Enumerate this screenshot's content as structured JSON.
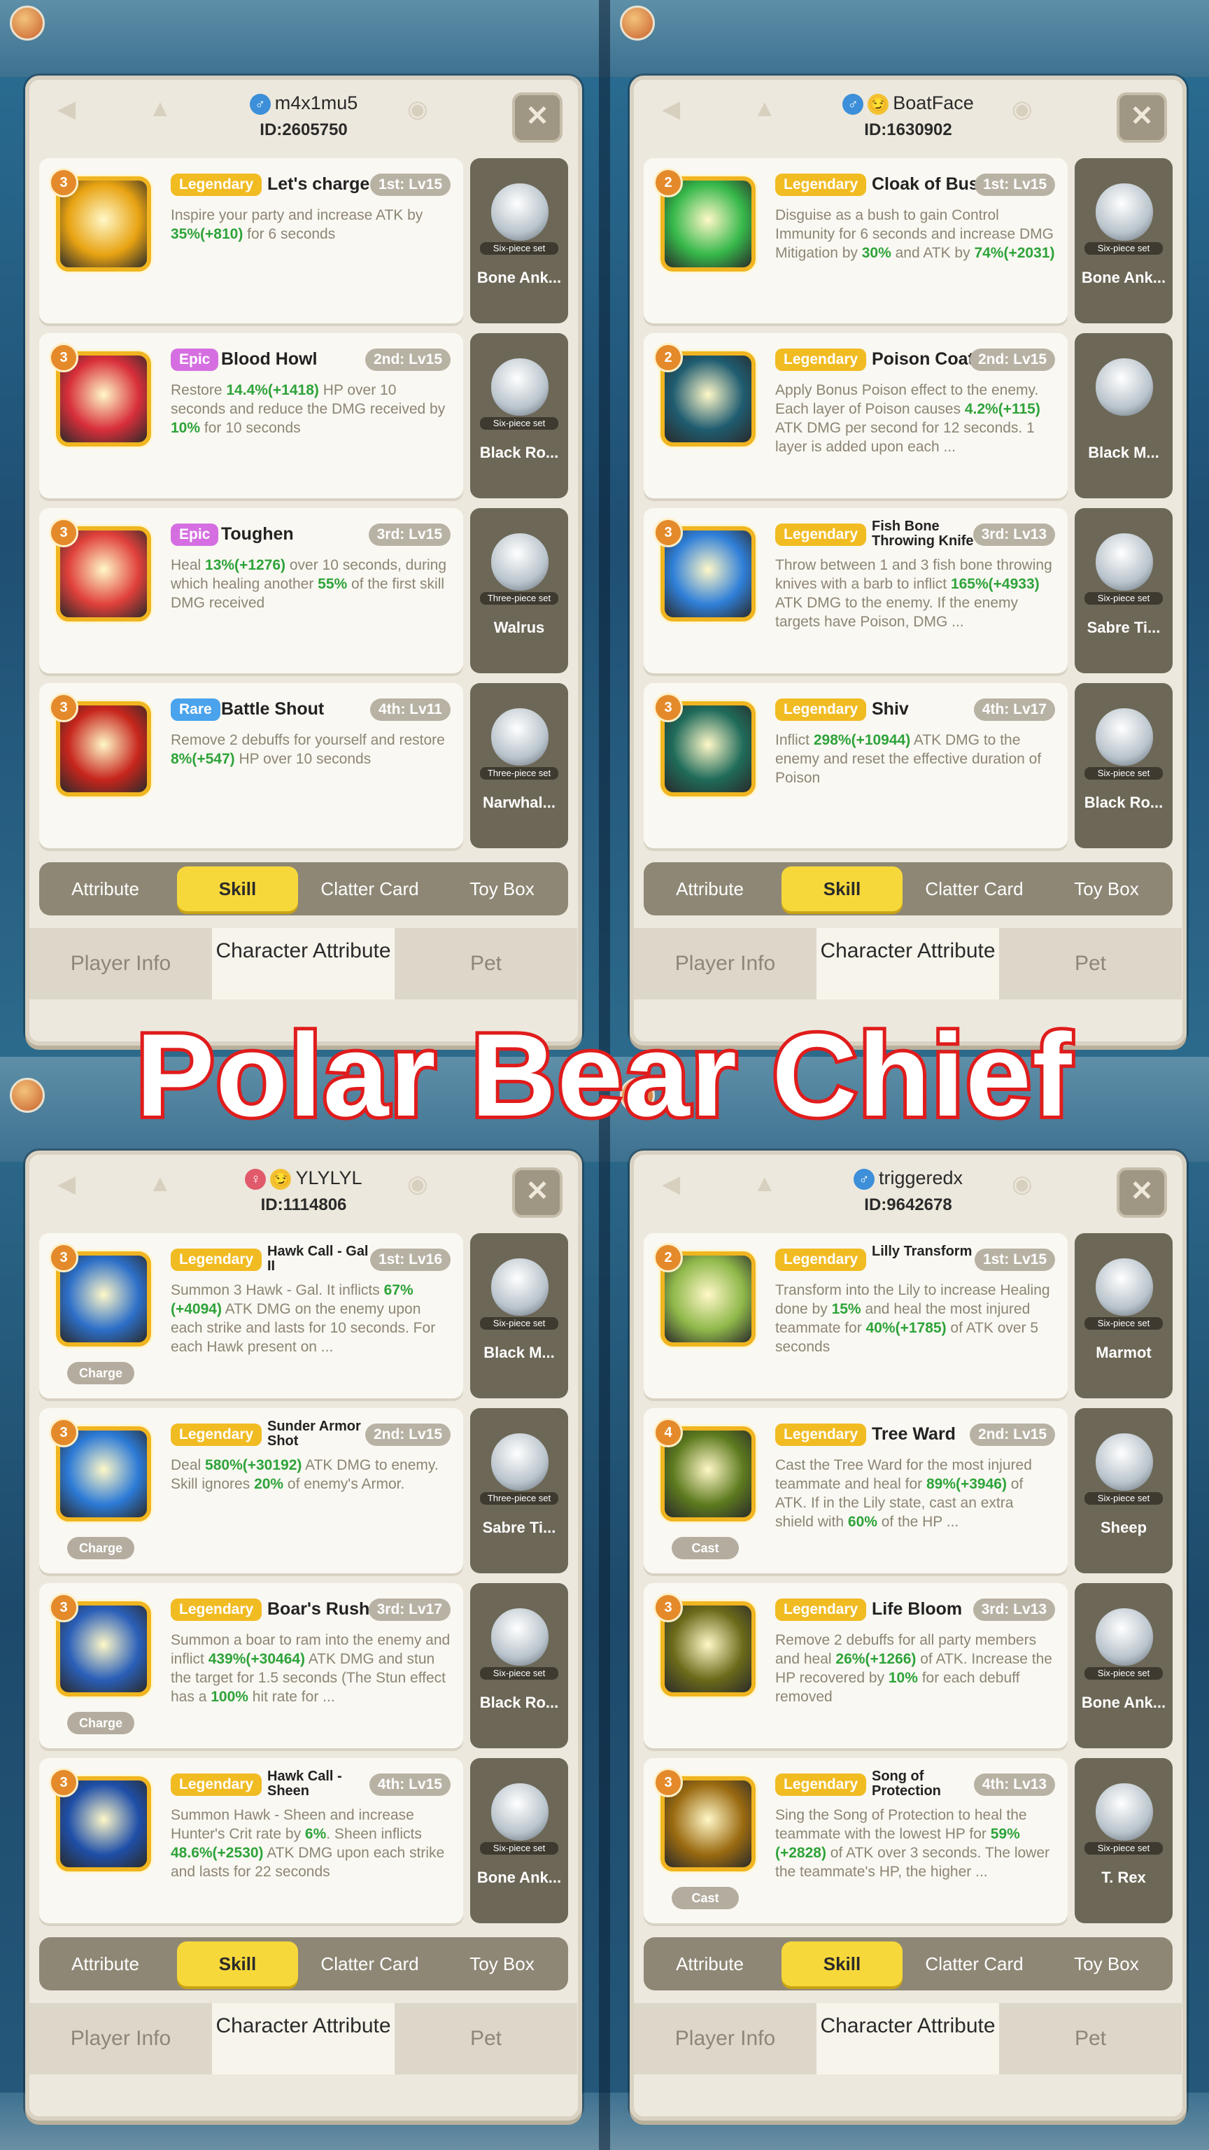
{
  "banner": "Polar Bear Chief",
  "subtabs": [
    "Attribute",
    "Skill",
    "Clatter Card",
    "Toy Box"
  ],
  "maintabs": [
    "Player Info",
    "Character Attribute",
    "Pet"
  ],
  "colors": {
    "legendary": "#f1bb22",
    "epic": "#d56fe1",
    "rare": "#4aa3ec",
    "green_value": "#2ea33a",
    "active_tab": "#f7d83b"
  },
  "panels": [
    {
      "name": "m4x1mu5",
      "id": "ID:2605750",
      "icons": [
        "gender-male-icon"
      ],
      "skills": [
        {
          "level": "3",
          "rarity": "Legendary",
          "name": "Let's charge",
          "slot": "1st: Lv15",
          "desc": "Inspire your party and increase ATK by 35%(+810) for 6 seconds",
          "badge": "",
          "pet_set": "Six-piece set",
          "pet": "Bone Ank...",
          "icon_color": "#e8a312"
        },
        {
          "level": "3",
          "rarity": "Epic",
          "name": "Blood Howl",
          "slot": "2nd: Lv15",
          "desc": "Restore 14.4%(+1418) HP over 10 seconds and reduce the DMG received by 10% for 10 seconds",
          "badge": "",
          "pet_set": "Six-piece set",
          "pet": "Black Ro...",
          "icon_color": "#d82f3a"
        },
        {
          "level": "3",
          "rarity": "Epic",
          "name": "Toughen",
          "slot": "3rd: Lv15",
          "desc": "Heal 13%(+1276) over 10 seconds, during which healing another 55% of the first skill DMG received",
          "badge": "",
          "pet_set": "Three-piece set",
          "pet": "Walrus",
          "icon_color": "#e0403a"
        },
        {
          "level": "3",
          "rarity": "Rare",
          "name": "Battle Shout",
          "slot": "4th: Lv11",
          "desc": "Remove 2 debuffs for yourself and restore 8%(+547) HP over 10 seconds",
          "badge": "",
          "pet_set": "Three-piece set",
          "pet": "Narwhal...",
          "icon_color": "#c7261c"
        }
      ]
    },
    {
      "name": "BoatFace",
      "id": "ID:1630902",
      "icons": [
        "gender-male-icon",
        "emoji-face-icon"
      ],
      "skills": [
        {
          "level": "2",
          "rarity": "Legendary",
          "name": "Cloak of Bush",
          "slot": "1st: Lv15",
          "desc": "Disguise as a bush to gain Control Immunity for 6 seconds and increase DMG Mitigation by 30% and ATK by 74%(+2031)",
          "badge": "",
          "pet_set": "Six-piece set",
          "pet": "Bone Ank...",
          "icon_color": "#36b84a"
        },
        {
          "level": "2",
          "rarity": "Legendary",
          "name": "Poison Coat",
          "slot": "2nd: Lv15",
          "desc": "Apply Bonus Poison effect to the enemy. Each layer of Poison causes 4.2%(+115) ATK DMG per second for 12 seconds. 1 layer is added upon each ...",
          "badge": "",
          "pet_set": "",
          "pet": "Black M...",
          "icon_color": "#1f5c70"
        },
        {
          "level": "3",
          "rarity": "Legendary",
          "name": "Fish Bone Throwing Knife",
          "slot": "3rd: Lv13",
          "desc": "Throw between 1 and 3 fish bone throwing knives with a barb to inflict 165%(+4933) ATK DMG to the enemy. If the enemy targets have Poison, DMG ...",
          "badge": "",
          "pet_set": "Six-piece set",
          "pet": "Sabre Ti...",
          "icon_color": "#2f7fd8"
        },
        {
          "level": "3",
          "rarity": "Legendary",
          "name": "Shiv",
          "slot": "4th: Lv17",
          "desc": "Inflict 298%(+10944) ATK DMG to the enemy and reset the effective duration of Poison",
          "badge": "",
          "pet_set": "Six-piece set",
          "pet": "Black Ro...",
          "icon_color": "#1f6b5a"
        }
      ]
    },
    {
      "name": "YLYLYL",
      "id": "ID:1114806",
      "icons": [
        "gender-female-icon",
        "emoji-face-icon"
      ],
      "skills": [
        {
          "level": "3",
          "rarity": "Legendary",
          "name": "Hawk Call - Gal II",
          "slot": "1st: Lv16",
          "desc": "Summon 3 Hawk - Gal. It inflicts 67%(+4094) ATK DMG on the enemy upon each strike and lasts for 10 seconds. For each Hawk present on ...",
          "badge": "Charge",
          "pet_set": "Six-piece set",
          "pet": "Black M...",
          "icon_color": "#2d6fc8"
        },
        {
          "level": "3",
          "rarity": "Legendary",
          "name": "Sunder Armor Shot",
          "slot": "2nd: Lv15",
          "desc": "Deal 580%(+30192) ATK DMG to enemy. Skill ignores 20% of enemy's Armor.",
          "badge": "Charge",
          "pet_set": "Three-piece set",
          "pet": "Sabre Ti...",
          "icon_color": "#2c7ad6"
        },
        {
          "level": "3",
          "rarity": "Legendary",
          "name": "Boar's Rush",
          "slot": "3rd: Lv17",
          "desc": "Summon a boar to ram into the enemy and inflict 439%(+30464) ATK DMG and stun the target for 1.5 seconds (The Stun effect has a 100% hit rate for ...",
          "badge": "Charge",
          "pet_set": "Six-piece set",
          "pet": "Black Ro...",
          "icon_color": "#2a5fb8"
        },
        {
          "level": "3",
          "rarity": "Legendary",
          "name": "Hawk Call - Sheen",
          "slot": "4th: Lv15",
          "desc": "Summon Hawk - Sheen and increase Hunter's Crit rate by 6%. Sheen inflicts 48.6%(+2530) ATK DMG upon each strike and lasts for 22 seconds",
          "badge": "",
          "pet_set": "Six-piece set",
          "pet": "Bone Ank...",
          "icon_color": "#1f4fa8"
        }
      ]
    },
    {
      "name": "triggeredx",
      "id": "ID:9642678",
      "icons": [
        "gender-male-icon"
      ],
      "skills": [
        {
          "level": "2",
          "rarity": "Legendary",
          "name": "Lilly Transform",
          "slot": "1st: Lv15",
          "desc": "Transform into the Lily to increase Healing done by 15% and heal the most injured teammate for 40%(+1785) of ATK over 5 seconds",
          "badge": "",
          "pet_set": "Six-piece set",
          "pet": "Marmot",
          "icon_color": "#8fb84a"
        },
        {
          "level": "4",
          "rarity": "Legendary",
          "name": "Tree Ward",
          "slot": "2nd: Lv15",
          "desc": "Cast the Tree Ward for the most injured teammate and heal for 89%(+3946) of ATK. If in the Lily state, cast an extra shield with 60% of the HP ...",
          "badge": "Cast",
          "pet_set": "Six-piece set",
          "pet": "Sheep",
          "icon_color": "#5d7a1e"
        },
        {
          "level": "3",
          "rarity": "Legendary",
          "name": "Life Bloom",
          "slot": "3rd: Lv13",
          "desc": "Remove 2 debuffs for all party members and heal 26%(+1266) of ATK. Increase the HP recovered by 10% for each debuff removed",
          "badge": "",
          "pet_set": "Six-piece set",
          "pet": "Bone Ank...",
          "icon_color": "#6b6a1a"
        },
        {
          "level": "3",
          "rarity": "Legendary",
          "name": "Song of Protection",
          "slot": "4th: Lv13",
          "desc": "Sing the Song of Protection to heal the teammate with the lowest HP for 59%(+2828) of ATK over 3 seconds. The lower the teammate's HP, the higher ...",
          "badge": "Cast",
          "pet_set": "Six-piece set",
          "pet": "T. Rex",
          "icon_color": "#9a6a10"
        }
      ]
    }
  ]
}
